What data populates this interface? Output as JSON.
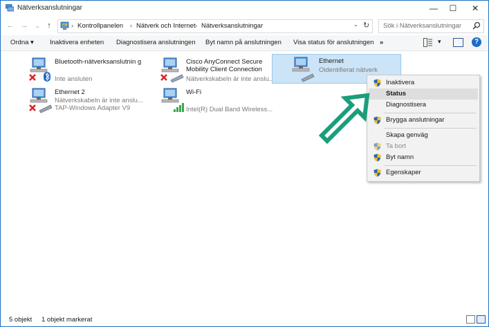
{
  "window": {
    "title": "Nätverksanslutningar",
    "minimize_glyph": "—",
    "maximize_glyph": "☐",
    "close_glyph": "✕"
  },
  "nav": {
    "back_glyph": "←",
    "forward_glyph": "→",
    "recent_glyph": "⌄",
    "up_glyph": "↑",
    "breadcrumbs": [
      "Kontrollpanelen",
      "Nätverk och Internet",
      "Nätverksanslutningar"
    ],
    "separator": "›",
    "dropdown_glyph": "⌄",
    "refresh_glyph": "↻"
  },
  "search": {
    "placeholder": "Sök i Nätverksanslutningar"
  },
  "toolbar": {
    "organize": "Ordna ▾",
    "items": [
      "Inaktivera enheten",
      "Diagnostisera anslutningen",
      "Byt namn på anslutningen",
      "Visa status för anslutningen"
    ],
    "more": "»",
    "view_dropdown": "▾",
    "help": "?"
  },
  "connections": [
    {
      "name": "Bluetooth-nätverksanslutnin g",
      "status": "Inte ansluten",
      "device": ""
    },
    {
      "name": "Cisco AnyConnect Secure Mobility Client Connection",
      "status": "Nätverkskabeln är inte anslu...",
      "device": ""
    },
    {
      "name": "Ethernet",
      "status": "Oidentifierat nätverk",
      "device": ""
    },
    {
      "name": "Ethernet 2",
      "status": "Nätverkskabeln är inte anslu...",
      "device": "TAP-Windows Adapter V9"
    },
    {
      "name": "Wi-Fi",
      "status": "Intel(R) Dual Band Wireless...",
      "device": ""
    }
  ],
  "context_menu": {
    "items": [
      {
        "label": "Inaktivera"
      },
      {
        "label": "Status"
      },
      {
        "label": "Diagnostisera"
      },
      {
        "label": "Brygga anslutningar"
      },
      {
        "label": "Skapa genväg"
      },
      {
        "label": "Ta bort"
      },
      {
        "label": "Byt namn"
      },
      {
        "label": "Egenskaper"
      }
    ]
  },
  "statusbar": {
    "count": "5 objekt",
    "selected": "1 objekt markerat"
  },
  "colors": {
    "selection": "#cce4f7",
    "arrow": "#1a9e7b",
    "shield_blue": "#2a64b8",
    "shield_yellow": "#f2c21a",
    "error_red": "#d8262b"
  }
}
